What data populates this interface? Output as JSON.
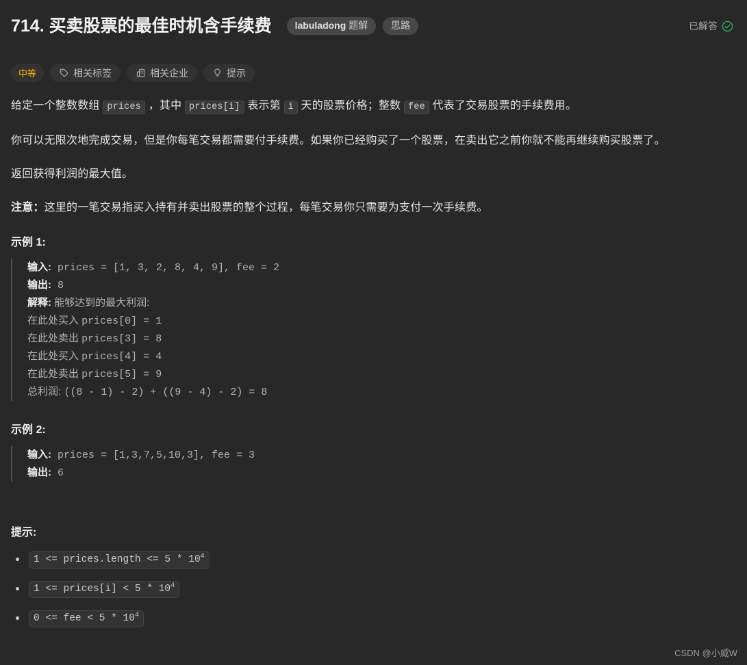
{
  "colors": {
    "background": "#282828",
    "text": "#e3e3e3",
    "difficulty_accent": "#ffb800",
    "solved_accent": "#2db55d",
    "code_text": "#b4b4b4",
    "pill_bg": "#474747",
    "tag_bg": "#323232"
  },
  "header": {
    "title_number": "714.",
    "title_text": "买卖股票的最佳时机含手续费",
    "title_full": "714. 买卖股票的最佳时机含手续费",
    "pills": [
      {
        "name": "labuladong-solution",
        "brand": "labuladong",
        "suffix": "题解"
      },
      {
        "name": "idea",
        "label": "思路"
      }
    ],
    "status": {
      "label": "已解答",
      "icon": "check-circle-icon"
    }
  },
  "tags": [
    {
      "name": "difficulty",
      "label": "中等",
      "icon": null
    },
    {
      "name": "related-topics",
      "label": "相关标签",
      "icon": "tag-icon"
    },
    {
      "name": "related-companies",
      "label": "相关企业",
      "icon": "building-icon"
    },
    {
      "name": "hint",
      "label": "提示",
      "icon": "lightbulb-icon"
    }
  ],
  "description": {
    "p1": {
      "seg1": "给定一个整数数组 ",
      "code1": "prices",
      "seg2": " ，其中 ",
      "code2": "prices[i]",
      "seg3": " 表示第 ",
      "code3": "i",
      "seg4": " 天的股票价格；整数 ",
      "code4": "fee",
      "seg5": " 代表了交易股票的手续费用。"
    },
    "p2": "你可以无限次地完成交易，但是你每笔交易都需要付手续费。如果你已经购买了一个股票，在卖出它之前你就不能再继续购买股票了。",
    "p3": "返回获得利润的最大值。",
    "p4": {
      "label": "注意：",
      "text": "这里的一笔交易指买入持有并卖出股票的整个过程，每笔交易你只需要为支付一次手续费。"
    }
  },
  "examples": [
    {
      "heading": "示例 1:",
      "lines": [
        {
          "label": "输入:",
          "code": " prices = [1, 3, 2, 8, 4, 9], fee = 2"
        },
        {
          "label": "输出:",
          "code": " 8"
        },
        {
          "label": "解释:",
          "cn": " 能够达到的最大利润:"
        },
        {
          "cn": "在此处买入 ",
          "code": "prices[0] = 1"
        },
        {
          "cn": "在此处卖出 ",
          "code": "prices[3] = 8"
        },
        {
          "cn": "在此处买入 ",
          "code": "prices[4] = 4"
        },
        {
          "cn": "在此处卖出 ",
          "code": "prices[5] = 9"
        },
        {
          "cn": "总利润: ",
          "code": "((8 - 1) - 2) + ((9 - 4) - 2) = 8"
        }
      ]
    },
    {
      "heading": "示例 2:",
      "lines": [
        {
          "label": "输入:",
          "code": " prices = [1,3,7,5,10,3], fee = 3"
        },
        {
          "label": "输出:",
          "code": " 6"
        }
      ]
    }
  ],
  "constraints": {
    "heading": "提示:",
    "items": [
      {
        "base": "1 <= prices.length <= 5 * 10",
        "exp": "4"
      },
      {
        "base": "1 <= prices[i] < 5 * 10",
        "exp": "4"
      },
      {
        "base": "0 <= fee < 5 * 10",
        "exp": "4"
      }
    ]
  },
  "watermark": "CSDN @小威W"
}
